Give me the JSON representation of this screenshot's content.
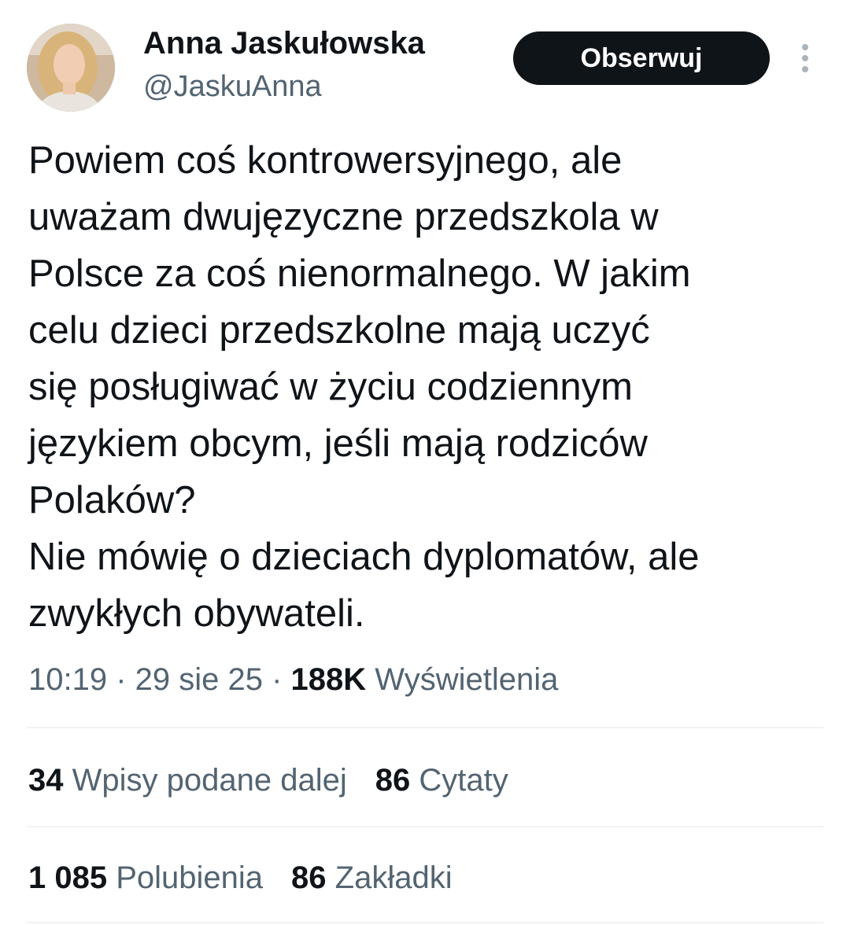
{
  "author": {
    "name": "Anna Jaskułowska",
    "handle": "@JaskuAnna",
    "avatar_icon": "avatar-photo"
  },
  "actions": {
    "follow_label": "Obserwuj",
    "more_icon": "more-vertical-icon"
  },
  "tweet": {
    "text": "Powiem coś kontrowersyjnego, ale\nuważam dwujęzyczne przedszkola w\nPolsce za coś nienormalnego. W jakim\ncelu dzieci przedszkolne mają uczyć\nsię posługiwać w życiu codziennym\njęzykiem obcym, jeśli mają rodziców\nPolaków?\nNie mówię o dzieciach dyplomatów, ale\nzwykłych obywateli."
  },
  "meta": {
    "time": "10:19",
    "sep1": " · ",
    "date": "29 sie 25",
    "sep2": " · ",
    "views_count": "188K",
    "views_label": " Wyświetlenia"
  },
  "stats_row1": [
    {
      "count": "34",
      "label": " Wpisy podane dalej"
    },
    {
      "count": "86",
      "label": " Cytaty"
    }
  ],
  "stats_row2": [
    {
      "count": "1 085",
      "label": " Polubienia"
    },
    {
      "count": "86",
      "label": " Zakładki"
    }
  ],
  "colors": {
    "text": "#0f1419",
    "secondary": "#536471",
    "divider": "#eff3f4",
    "button_bg": "#0f1419"
  }
}
